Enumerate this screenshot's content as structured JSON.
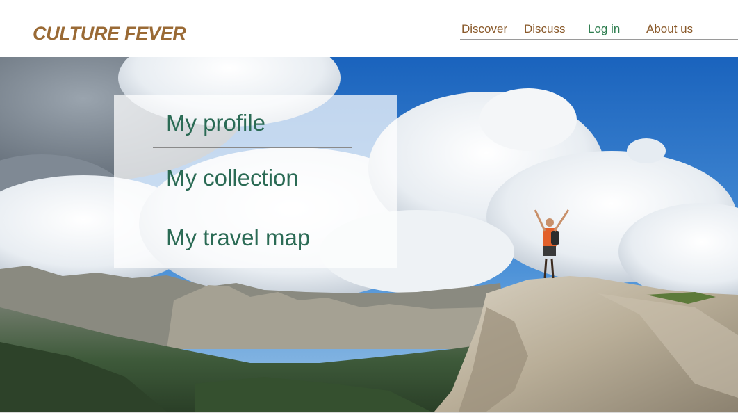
{
  "colors": {
    "brand": "#9a6a35",
    "nav_text": "#8a5a2b",
    "nav_active": "#2e7d4f",
    "menu_text": "#2b6b55",
    "sky": "#1e6fc8"
  },
  "header": {
    "logo": "CULTURE FEVER",
    "nav": [
      {
        "label": "Discover",
        "active": false
      },
      {
        "label": "Discuss",
        "active": false
      },
      {
        "label": "Log in",
        "active": true
      },
      {
        "label": "About us",
        "active": false
      }
    ]
  },
  "menu": {
    "items": [
      {
        "label": "My profile"
      },
      {
        "label": "My collection"
      },
      {
        "label": "My travel map"
      }
    ]
  }
}
